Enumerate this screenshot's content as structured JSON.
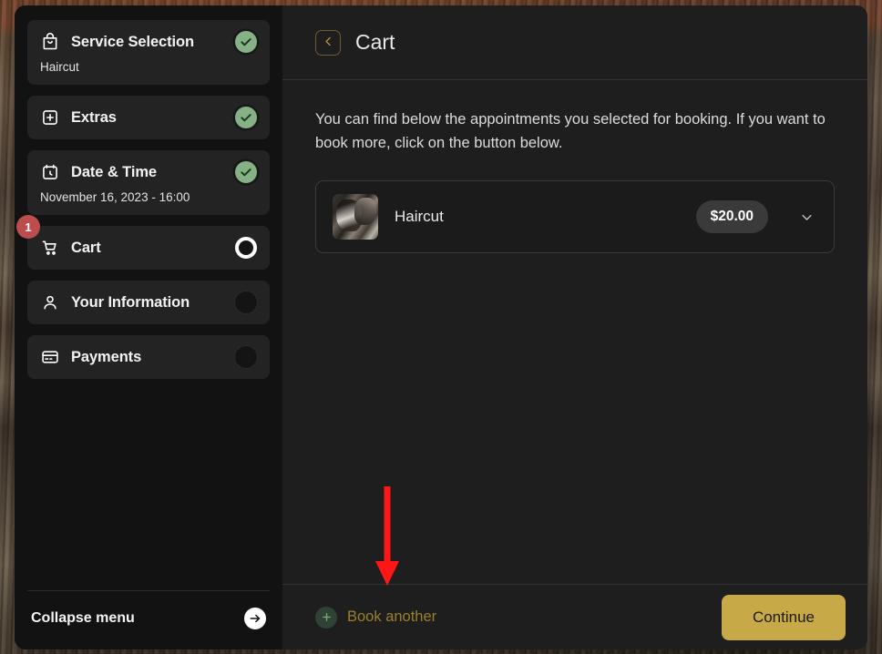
{
  "sidebar": {
    "steps": [
      {
        "label": "Service Selection",
        "sub": "Haircut",
        "icon": "bag-icon",
        "state": "done"
      },
      {
        "label": "Extras",
        "sub": "",
        "icon": "plus-square-icon",
        "state": "done"
      },
      {
        "label": "Date & Time",
        "sub": "November 16, 2023 - 16:00",
        "icon": "calendar-clock-icon",
        "state": "done"
      },
      {
        "label": "Cart",
        "sub": "",
        "icon": "cart-icon",
        "state": "active",
        "badge": "1"
      },
      {
        "label": "Your Information",
        "sub": "",
        "icon": "user-icon",
        "state": "todo"
      },
      {
        "label": "Payments",
        "sub": "",
        "icon": "credit-card-icon",
        "state": "todo"
      }
    ],
    "collapse_label": "Collapse menu",
    "collapse_icon": "arrow-right-circle-icon"
  },
  "header": {
    "back_icon": "chevron-left-icon",
    "title": "Cart"
  },
  "main": {
    "intro": "You can find below the appointments you selected for booking. If you want to book more, click on the button below.",
    "cart_items": [
      {
        "name": "Haircut",
        "price": "$20.00",
        "expand_icon": "chevron-down-icon",
        "thumb": "haircut-photo"
      }
    ]
  },
  "footer": {
    "book_another_label": "Book another",
    "book_another_icon": "plus-icon",
    "continue_label": "Continue"
  },
  "annotation": {
    "arrow_color": "#ff1616",
    "direction": "down"
  },
  "colors": {
    "accent_gold": "#c7a947",
    "check_green": "#85b185",
    "badge_red": "#bc4d4d",
    "panel_bg": "#1e1e1e",
    "sidebar_bg": "#121212"
  }
}
